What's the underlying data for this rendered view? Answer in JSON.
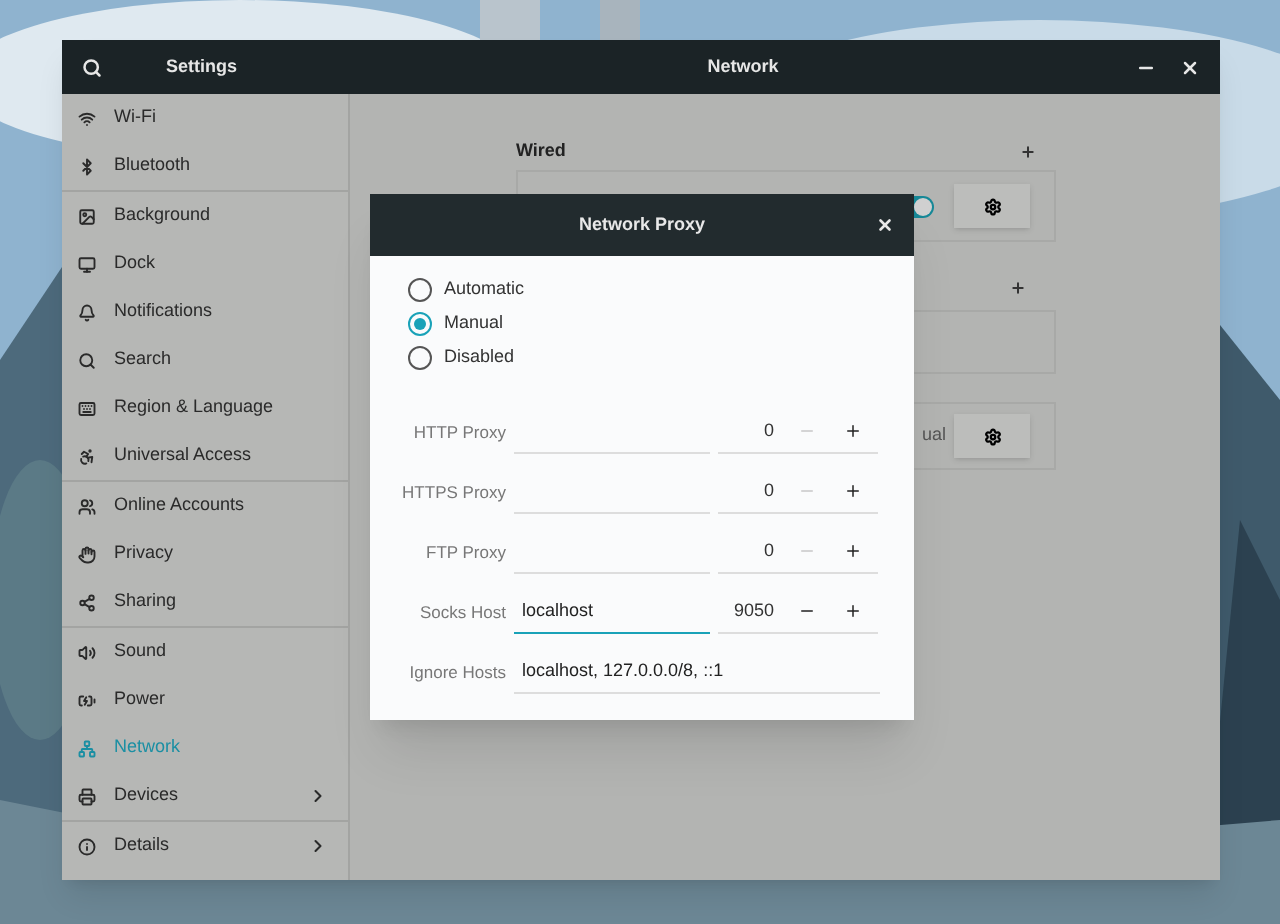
{
  "window": {
    "title": "Settings",
    "page_title": "Network"
  },
  "sidebar": {
    "groups": [
      [
        {
          "label": "Wi-Fi",
          "selected": false,
          "expandable": false
        },
        {
          "label": "Bluetooth",
          "selected": false,
          "expandable": false
        }
      ],
      [
        {
          "label": "Background",
          "selected": false,
          "expandable": false
        },
        {
          "label": "Dock",
          "selected": false,
          "expandable": false
        },
        {
          "label": "Notifications",
          "selected": false,
          "expandable": false
        },
        {
          "label": "Search",
          "selected": false,
          "expandable": false
        },
        {
          "label": "Region & Language",
          "selected": false,
          "expandable": false
        },
        {
          "label": "Universal Access",
          "selected": false,
          "expandable": false
        }
      ],
      [
        {
          "label": "Online Accounts",
          "selected": false,
          "expandable": false
        },
        {
          "label": "Privacy",
          "selected": false,
          "expandable": false
        },
        {
          "label": "Sharing",
          "selected": false,
          "expandable": false
        }
      ],
      [
        {
          "label": "Sound",
          "selected": false,
          "expandable": false
        },
        {
          "label": "Power",
          "selected": false,
          "expandable": false
        },
        {
          "label": "Network",
          "selected": true,
          "expandable": false
        },
        {
          "label": "Devices",
          "selected": false,
          "expandable": true
        }
      ],
      [
        {
          "label": "Details",
          "selected": false,
          "expandable": true
        }
      ]
    ]
  },
  "main": {
    "wired": {
      "heading": "Wired",
      "switch_on": true
    },
    "proxy_partial": "ual"
  },
  "dialog": {
    "title": "Network Proxy",
    "modes": [
      {
        "label": "Automatic",
        "selected": false
      },
      {
        "label": "Manual",
        "selected": true
      },
      {
        "label": "Disabled",
        "selected": false
      }
    ],
    "proxies": [
      {
        "label": "HTTP Proxy",
        "port": "0",
        "focused": false,
        "minus_disabled": true
      },
      {
        "label": "HTTPS Proxy",
        "port": "0",
        "focused": false,
        "minus_disabled": true
      },
      {
        "label": "FTP Proxy",
        "port": "0",
        "focused": false,
        "minus_disabled": true
      },
      {
        "label": "Socks Host",
        "host": "localhost",
        "port": "9050",
        "focused": true,
        "minus_disabled": false
      }
    ],
    "ignore_hosts": {
      "label": "Ignore Hosts",
      "value": "localhost, 127.0.0.0/8, ::1"
    }
  }
}
